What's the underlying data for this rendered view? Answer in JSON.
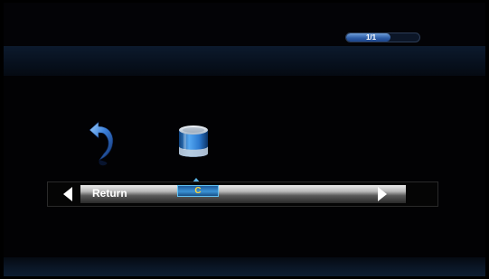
{
  "pagination": {
    "text": "1/1",
    "fraction": 0.6
  },
  "menu": {
    "return_label": "Return",
    "drives": [
      {
        "label": "C",
        "icon": "drive-icon",
        "selected": true
      }
    ]
  },
  "icons": {
    "return": "return-icon",
    "drive": "drive-icon",
    "left": "left-arrow-icon",
    "right": "right-arrow-icon"
  },
  "colors": {
    "background": "#000000",
    "accent_blue": "#3b93d6",
    "highlight_text": "#ffd43a"
  }
}
